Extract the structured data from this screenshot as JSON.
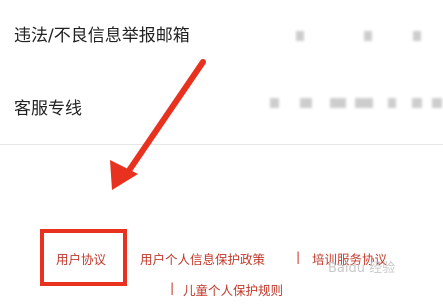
{
  "rows": [
    {
      "label": "违法/不良信息举报邮箱"
    },
    {
      "label": "客服专线"
    }
  ],
  "footer": {
    "links": [
      "用户协议",
      "用户个人信息保护政策",
      "培训服务协议",
      "儿童个人保护规则"
    ],
    "separator": "|"
  },
  "annotations": {
    "highlight_color": "#e8321f",
    "arrow": "red-arrow"
  },
  "watermark": "Baidu 经验"
}
